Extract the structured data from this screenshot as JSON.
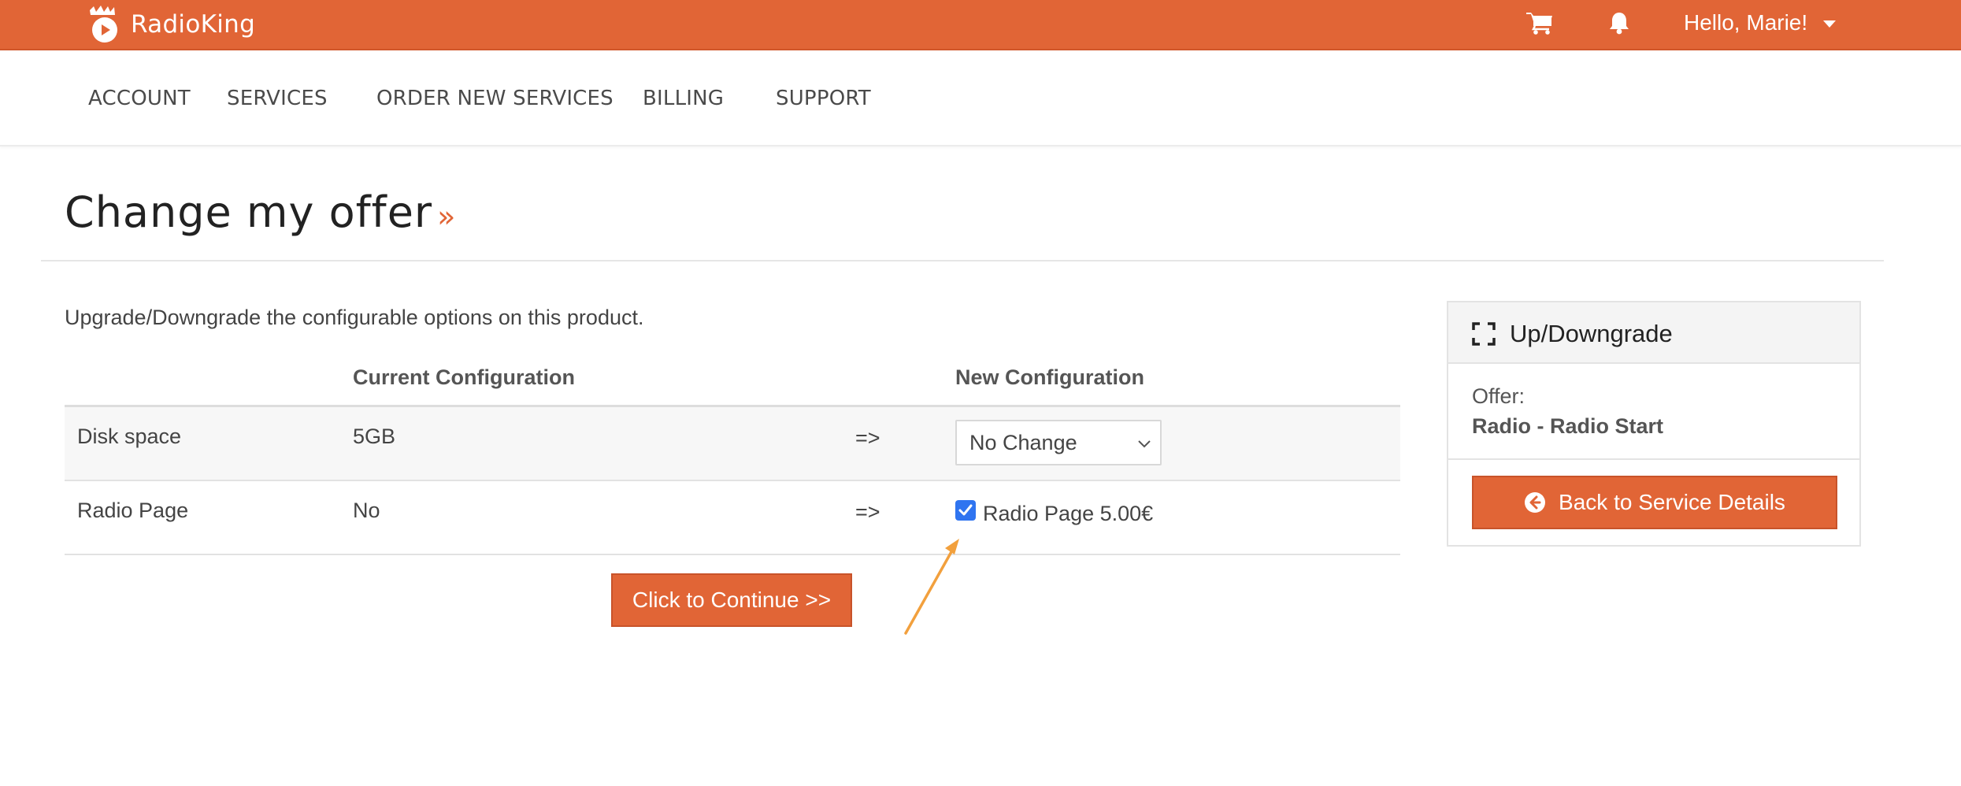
{
  "brand": {
    "name": "RadioKing",
    "color": "#e16536"
  },
  "header": {
    "cart_icon": "cart-icon",
    "bell_icon": "bell-icon",
    "user_greeting": "Hello, Marie!"
  },
  "nav": {
    "items": [
      "ACCOUNT",
      "SERVICES",
      "ORDER NEW SERVICES",
      "BILLING",
      "SUPPORT"
    ]
  },
  "page": {
    "title": "Change my offer",
    "title_suffix": "»",
    "intro": "Upgrade/Downgrade the configurable options on this product."
  },
  "table": {
    "headers": {
      "current": "Current Configuration",
      "new": "New Configuration"
    },
    "rows": [
      {
        "option": "Disk space",
        "current": "5GB",
        "arrow": "=>",
        "new_select_value": "No Change"
      },
      {
        "option": "Radio Page",
        "current": "No",
        "arrow": "=>",
        "new_checkbox_label": "Radio Page 5.00€",
        "new_checkbox_checked": true
      }
    ]
  },
  "actions": {
    "continue_label": "Click to Continue >>"
  },
  "panel": {
    "title": "Up/Downgrade",
    "offer_label": "Offer:",
    "offer_value": "Radio - Radio Start",
    "back_label": "Back to Service Details"
  },
  "colors": {
    "accent": "#e16536",
    "checkbox": "#2f74f0",
    "annotation": "#f2a03d"
  }
}
